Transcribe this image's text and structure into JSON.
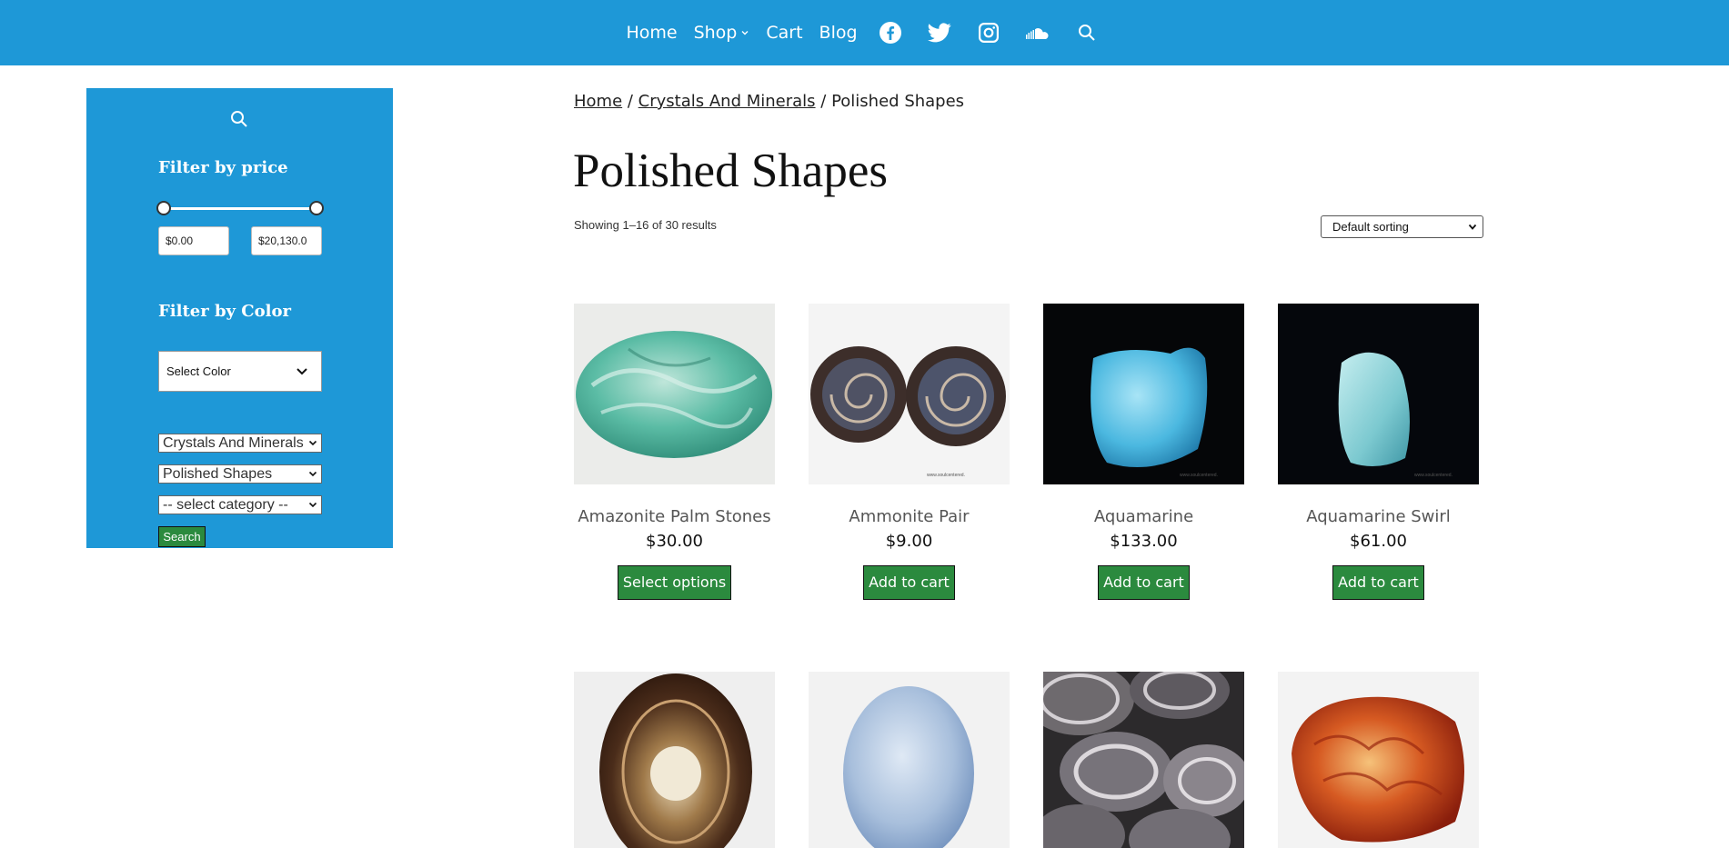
{
  "nav": {
    "items": [
      {
        "label": "Home"
      },
      {
        "label": "Shop"
      },
      {
        "label": "Cart"
      },
      {
        "label": "Blog"
      }
    ],
    "icons": [
      "facebook-icon",
      "twitter-icon",
      "instagram-icon",
      "soundcloud-icon",
      "search-icon"
    ]
  },
  "sidebar": {
    "filter_price_heading": "Filter by price",
    "price_min": "$0.00",
    "price_max": "$20,130.0",
    "filter_color_heading": "Filter by Color",
    "color_select": "Select Color",
    "category_selects": [
      "Crystals And Minerals",
      "Polished Shapes",
      "-- select category --"
    ],
    "search_button": "Search"
  },
  "breadcrumb": {
    "home": "Home",
    "sep1": " / ",
    "category": "Crystals And Minerals",
    "sep2": " / ",
    "current": "Polished Shapes"
  },
  "page_title": "Polished Shapes",
  "result_count": "Showing 1–16 of 30 results",
  "sort": {
    "selected": "Default sorting"
  },
  "products": [
    {
      "name": "Amazonite Palm Stones",
      "price": "$30.00",
      "button": "Select options"
    },
    {
      "name": "Ammonite Pair",
      "price": "$9.00",
      "button": "Add to cart"
    },
    {
      "name": "Aquamarine",
      "price": "$133.00",
      "button": "Add to cart"
    },
    {
      "name": "Aquamarine Swirl",
      "price": "$61.00",
      "button": "Add to cart"
    },
    {
      "name": "",
      "price": "",
      "button": ""
    },
    {
      "name": "",
      "price": "",
      "button": ""
    },
    {
      "name": "",
      "price": "",
      "button": ""
    },
    {
      "name": "",
      "price": "",
      "button": ""
    }
  ],
  "colors": {
    "brand_blue": "#1e98d7",
    "button_green": "#2b8a3e"
  }
}
